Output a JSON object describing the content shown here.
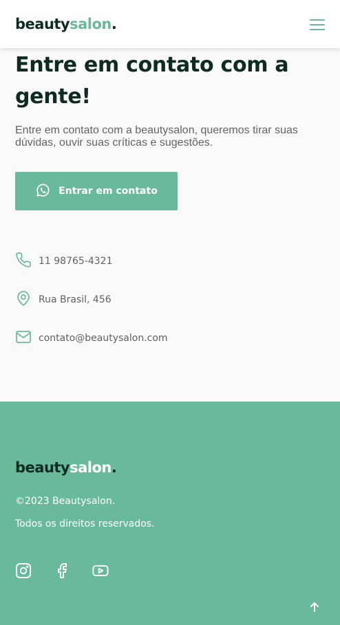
{
  "header": {
    "logo": {
      "part1": "beauty",
      "part2": "salon",
      "part3": "."
    },
    "menu_icon": "hamburger-menu-icon"
  },
  "contact": {
    "title": "Entre em contato com a gente!",
    "description": "Entre em contato com a beautysalon, queremos tirar suas dúvidas, ouvir suas críticas e sugestões.",
    "cta_label": "Entrar em contato",
    "cta_icon": "whatsapp-icon",
    "items": [
      {
        "icon": "phone-icon",
        "text": "11 98765-4321"
      },
      {
        "icon": "map-pin-icon",
        "text": "Rua Brasil, 456"
      },
      {
        "icon": "mail-icon",
        "text": "contato@beautysalon.com"
      }
    ]
  },
  "footer": {
    "logo": {
      "part1": "beauty",
      "part2": "salon",
      "part3": "."
    },
    "copyright": "©2023 Beautysalon.",
    "rights": "Todos os direitos reservados.",
    "socials": [
      "instagram-icon",
      "facebook-icon",
      "youtube-icon"
    ],
    "back_to_top_icon": "arrow-up-icon"
  },
  "colors": {
    "accent": "#69b99d",
    "dark": "#0d2b22",
    "text_muted": "#636363",
    "background": "#f9f9f9",
    "header_bg": "#ffffff"
  }
}
